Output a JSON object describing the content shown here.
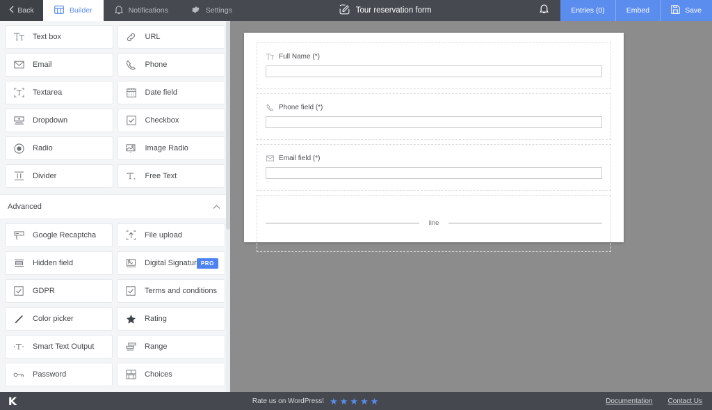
{
  "topbar": {
    "back_label": "Back",
    "tabs": [
      {
        "label": "Builder",
        "icon": "builder-icon",
        "active": true
      },
      {
        "label": "Notifications",
        "icon": "bell-icon",
        "active": false
      },
      {
        "label": "Settings",
        "icon": "gear-icon",
        "active": false
      }
    ],
    "form_title": "Tour reservation form",
    "title_icon": "pencil-edit-icon",
    "notifications_icon": "bell-icon",
    "actions": [
      {
        "label": "Entries (0)",
        "icon": ""
      },
      {
        "label": "Embed",
        "icon": ""
      },
      {
        "label": "Save",
        "icon": "save-disk-icon"
      }
    ],
    "accent_color": "#5b8def",
    "bar_color": "#464a50"
  },
  "sidebar": {
    "basic_fields": [
      {
        "label": "Text box",
        "icon": "text-box-icon"
      },
      {
        "label": "URL",
        "icon": "link-icon"
      },
      {
        "label": "Email",
        "icon": "envelope-icon"
      },
      {
        "label": "Phone",
        "icon": "phone-icon"
      },
      {
        "label": "Textarea",
        "icon": "textarea-icon"
      },
      {
        "label": "Date field",
        "icon": "calendar-icon"
      },
      {
        "label": "Dropdown",
        "icon": "dropdown-icon"
      },
      {
        "label": "Checkbox",
        "icon": "checkbox-icon"
      },
      {
        "label": "Radio",
        "icon": "radio-icon"
      },
      {
        "label": "Image Radio",
        "icon": "image-radio-icon"
      },
      {
        "label": "Divider",
        "icon": "divider-icon"
      },
      {
        "label": "Free Text",
        "icon": "free-text-icon"
      }
    ],
    "advanced_section": {
      "label": "Advanced",
      "collapse_icon": "chevron-up-icon",
      "expanded": true
    },
    "advanced_fields": [
      {
        "label": "Google Recaptcha",
        "icon": "recaptcha-icon",
        "badge": ""
      },
      {
        "label": "File upload",
        "icon": "upload-icon",
        "badge": ""
      },
      {
        "label": "Hidden field",
        "icon": "hidden-field-icon",
        "badge": ""
      },
      {
        "label": "Digital Signature",
        "icon": "signature-icon",
        "badge": "PRO"
      },
      {
        "label": "GDPR",
        "icon": "checkbox-icon",
        "badge": ""
      },
      {
        "label": "Terms and conditions",
        "icon": "checkbox-icon",
        "badge": ""
      },
      {
        "label": "Color picker",
        "icon": "color-picker-icon",
        "badge": ""
      },
      {
        "label": "Rating",
        "icon": "star-icon",
        "badge": ""
      },
      {
        "label": "Smart Text Output",
        "icon": "smart-text-icon",
        "badge": ""
      },
      {
        "label": "Range",
        "icon": "range-icon",
        "badge": ""
      },
      {
        "label": "Password",
        "icon": "key-icon",
        "badge": ""
      },
      {
        "label": "Choices",
        "icon": "choices-icon",
        "badge": ""
      }
    ],
    "badge_color": "#4d82f3"
  },
  "canvas": {
    "background_color": "#8c8c8c",
    "form_rows": [
      {
        "type": "field",
        "label": "Full Name (*)",
        "icon": "text-box-icon",
        "value": ""
      },
      {
        "type": "field",
        "label": "Phone field (*)",
        "icon": "phone-icon",
        "value": ""
      },
      {
        "type": "field",
        "label": "Email field (*)",
        "icon": "envelope-icon",
        "value": ""
      },
      {
        "type": "divider",
        "label": "line"
      }
    ]
  },
  "bottombar": {
    "logo": "K",
    "rate_text": "Rate us on WordPress!",
    "star_count": 5,
    "star_color": "#5b8def",
    "links": [
      {
        "label": "Documentation"
      },
      {
        "label": "Contact Us"
      }
    ]
  }
}
